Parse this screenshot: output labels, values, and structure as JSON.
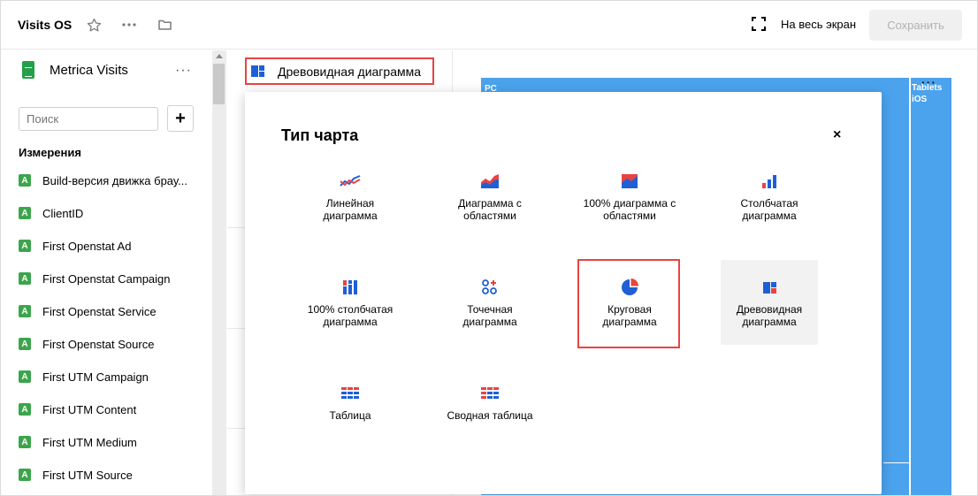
{
  "header": {
    "title": "Visits OS",
    "fullscreen_label": "На весь экран",
    "save_label": "Сохранить",
    "icons": [
      "star-icon",
      "more-icon",
      "folder-icon",
      "fullscreen-icon"
    ]
  },
  "sidebar": {
    "dataset_name": "Metrica Visits",
    "search_placeholder": "Поиск",
    "add_label": "+",
    "dimensions_title": "Измерения",
    "fields": [
      {
        "type": "A",
        "label": "Build-версия движка брау..."
      },
      {
        "type": "A",
        "label": "ClientID"
      },
      {
        "type": "A",
        "label": "First Openstat Ad"
      },
      {
        "type": "A",
        "label": "First Openstat Campaign"
      },
      {
        "type": "A",
        "label": "First Openstat Service"
      },
      {
        "type": "A",
        "label": "First Openstat Source"
      },
      {
        "type": "A",
        "label": "First UTM Campaign"
      },
      {
        "type": "A",
        "label": "First UTM Content"
      },
      {
        "type": "A",
        "label": "First UTM Medium"
      },
      {
        "type": "A",
        "label": "First UTM Source"
      }
    ]
  },
  "visualization": {
    "selected_label": "Древовидная диаграмма"
  },
  "chart_preview": {
    "labels": [
      "PC",
      "Tablets",
      "iOS"
    ],
    "fill_color": "#4ba3ee"
  },
  "dialog": {
    "title": "Тип чарта",
    "close_label": "×",
    "options": [
      {
        "label": "Линейная диаграмма",
        "icon": "line-chart-icon",
        "selected": false
      },
      {
        "label": "Диаграмма с областями",
        "icon": "area-chart-icon",
        "selected": false
      },
      {
        "label": "100% диаграмма с областями",
        "icon": "area-100-chart-icon",
        "selected": false
      },
      {
        "label": "Столбчатая диаграмма",
        "icon": "column-chart-icon",
        "selected": false
      },
      {
        "label": "100% столбчатая диаграмма",
        "icon": "column-100-chart-icon",
        "selected": false
      },
      {
        "label": "Точечная диаграмма",
        "icon": "scatter-chart-icon",
        "selected": false
      },
      {
        "label": "Круговая диаграмма",
        "icon": "pie-chart-icon",
        "selected": false,
        "highlighted": true
      },
      {
        "label": "Древовидная диаграмма",
        "icon": "treemap-icon",
        "selected": true
      },
      {
        "label": "Таблица",
        "icon": "table-icon",
        "selected": false
      },
      {
        "label": "Сводная таблица",
        "icon": "pivot-table-icon",
        "selected": false
      }
    ]
  },
  "colors": {
    "accent_blue": "#1f5fd6",
    "accent_red": "#e84343",
    "chart_blue": "#4ba3ee",
    "badge_green": "#3ca54b"
  }
}
